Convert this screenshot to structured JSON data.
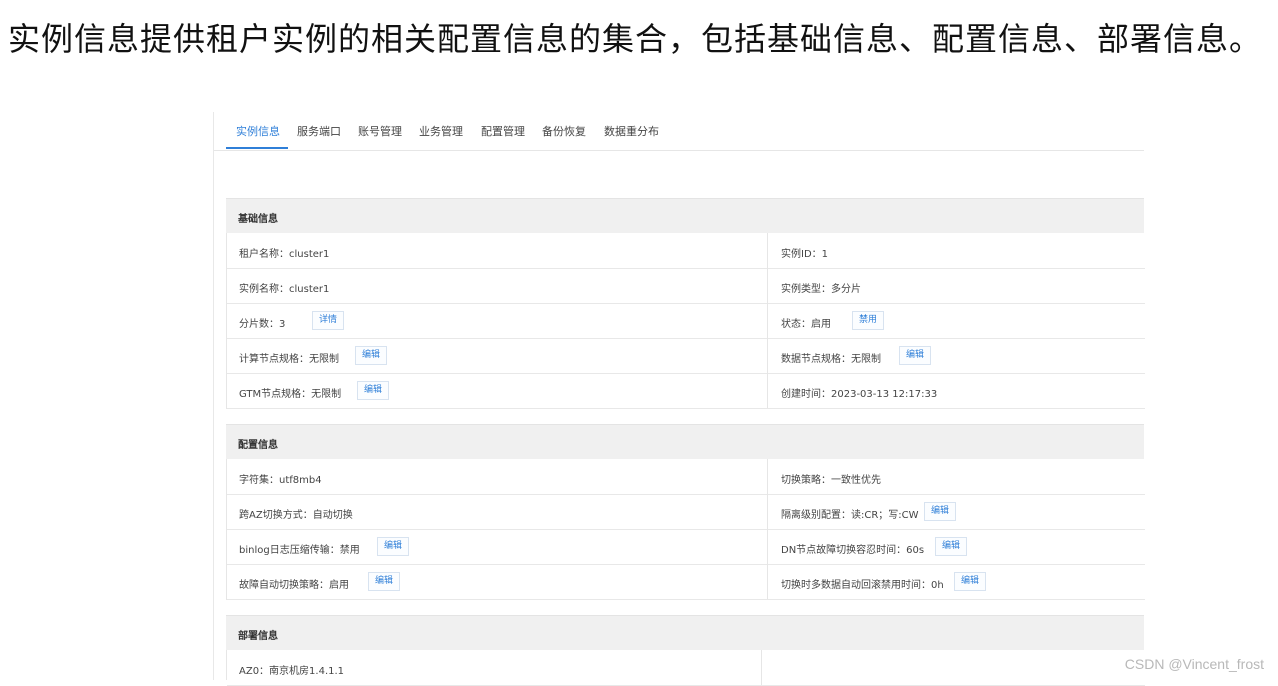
{
  "caption": "实例信息提供租户实例的相关配置信息的集合，包括基础信息、配置信息、部署信息。",
  "tabs": [
    "实例信息",
    "服务端口",
    "账号管理",
    "业务管理",
    "配置管理",
    "备份恢复",
    "数据重分布"
  ],
  "active_tab": "实例信息",
  "basic": {
    "title": "基础信息",
    "tenant_name": "租户名称：cluster1",
    "instance_id": "实例ID：1",
    "instance_name": "实例名称：cluster1",
    "instance_type": "实例类型：多分片",
    "shard_count": "分片数：3",
    "shard_detail_btn": "详情",
    "status": "状态：启用",
    "disable_btn": "禁用",
    "compute_spec": "计算节点规格：无限制",
    "compute_edit": "编辑",
    "data_spec": "数据节点规格：无限制",
    "data_edit": "编辑",
    "gtm_spec": "GTM节点规格：无限制",
    "gtm_edit": "编辑",
    "created": "创建时间：2023-03-13 12:17:33"
  },
  "config": {
    "title": "配置信息",
    "charset": "字符集：utf8mb4",
    "switch_policy": "切换策略：一致性优先",
    "az_switch": "跨AZ切换方式：自动切换",
    "isolation": "隔离级别配置：读:CR；写:CW",
    "isolation_edit": "编辑",
    "binlog": "binlog日志压缩传输：禁用",
    "binlog_edit": "编辑",
    "dn_timeout": "DN节点故障切换容忍时间：60s",
    "dn_edit": "编辑",
    "auto_failover": "故障自动切换策略：启用",
    "auto_failover_edit": "编辑",
    "rollback_time": "切换时多数据自动回滚禁用时间：0h",
    "rollback_edit": "编辑"
  },
  "deploy": {
    "title": "部署信息",
    "az0": "AZ0：南京机房1.4.1.1"
  },
  "watermark": "CSDN @Vincent_frost"
}
